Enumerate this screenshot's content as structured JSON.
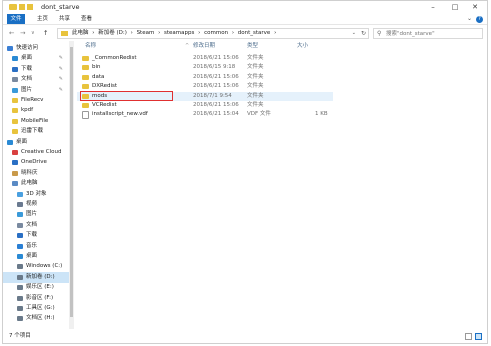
{
  "window": {
    "title": "dont_starve"
  },
  "ribbon": {
    "tabs": [
      "文件",
      "主页",
      "共享",
      "查看"
    ],
    "help": "?"
  },
  "nav_buttons": {
    "back": "←",
    "forward": "→",
    "recent": "∨",
    "up": "↑"
  },
  "address": {
    "crumbs": [
      "此电脑",
      "›",
      "新加卷 (D:)",
      "›",
      "Steam",
      "›",
      "steamapps",
      "›",
      "common",
      "›",
      "dont_starve",
      "›"
    ]
  },
  "search": {
    "placeholder": "搜索\"dont_starve\""
  },
  "sidebar": {
    "items": [
      {
        "label": "快速访问",
        "icon": "star-icon",
        "color": "#3b7fd4"
      },
      {
        "label": "桌面",
        "icon": "desktop-icon",
        "color": "#2a8ad4",
        "pinned": true
      },
      {
        "label": "下载",
        "icon": "download-icon",
        "color": "#2a6fc4",
        "pinned": true
      },
      {
        "label": "文档",
        "icon": "document-icon",
        "color": "#7a8aa0",
        "pinned": true
      },
      {
        "label": "图片",
        "icon": "pictures-icon",
        "color": "#3a9ad9",
        "pinned": true
      },
      {
        "label": "FileRecv",
        "icon": "folder-icon",
        "color": "#e8c33d"
      },
      {
        "label": "kpdf",
        "icon": "folder-icon",
        "color": "#e8c33d"
      },
      {
        "label": "MobileFile",
        "icon": "folder-icon",
        "color": "#e8c33d"
      },
      {
        "label": "迅雷下载",
        "icon": "folder-icon",
        "color": "#e8c33d"
      },
      {
        "label": "桌面",
        "icon": "desktop-icon",
        "color": "#2a8ad4"
      },
      {
        "label": "Creative Cloud",
        "icon": "creative-cloud-icon",
        "color": "#d94040"
      },
      {
        "label": "OneDrive",
        "icon": "cloud-icon",
        "color": "#2a6fc4"
      },
      {
        "label": "晓科庆",
        "icon": "user-icon",
        "color": "#c99a4a"
      },
      {
        "label": "此电脑",
        "icon": "computer-icon",
        "color": "#5a8ac4"
      },
      {
        "label": "3D 对象",
        "icon": "3d-objects-icon",
        "color": "#4aa0e0"
      },
      {
        "label": "视频",
        "icon": "video-icon",
        "color": "#6a7a90"
      },
      {
        "label": "图片",
        "icon": "pictures-icon",
        "color": "#3a9ad9"
      },
      {
        "label": "文档",
        "icon": "document-icon",
        "color": "#7a8aa0"
      },
      {
        "label": "下载",
        "icon": "download-icon",
        "color": "#2a6fc4"
      },
      {
        "label": "音乐",
        "icon": "music-icon",
        "color": "#2a7fd4"
      },
      {
        "label": "桌面",
        "icon": "desktop-icon",
        "color": "#2a8ad4"
      },
      {
        "label": "Windows (C:)",
        "icon": "drive-icon",
        "color": "#6a7a8a"
      },
      {
        "label": "新加卷 (D:)",
        "icon": "drive-icon",
        "color": "#6a7a8a",
        "selected": true
      },
      {
        "label": "娱乐区 (E:)",
        "icon": "drive-icon",
        "color": "#6a7a8a"
      },
      {
        "label": "影音区 (F:)",
        "icon": "drive-icon",
        "color": "#6a7a8a"
      },
      {
        "label": "工具区 (G:)",
        "icon": "drive-icon",
        "color": "#6a7a8a"
      },
      {
        "label": "文档区 (H:)",
        "icon": "drive-icon",
        "color": "#6a7a8a"
      }
    ]
  },
  "columns": {
    "name": "名称",
    "date": "修改日期",
    "type": "类型",
    "size": "大小"
  },
  "files": [
    {
      "name": "_CommonRedist",
      "date": "2018/6/21 15:06",
      "type": "文件夹",
      "size": "",
      "kind": "folder"
    },
    {
      "name": "bin",
      "date": "2018/6/15 9:18",
      "type": "文件夹",
      "size": "",
      "kind": "folder"
    },
    {
      "name": "data",
      "date": "2018/6/21 15:06",
      "type": "文件夹",
      "size": "",
      "kind": "folder"
    },
    {
      "name": "DXRedist",
      "date": "2018/6/21 15:06",
      "type": "文件夹",
      "size": "",
      "kind": "folder"
    },
    {
      "name": "mods",
      "date": "2018/7/1 9:54",
      "type": "文件夹",
      "size": "",
      "kind": "folder",
      "selected": true
    },
    {
      "name": "VCRedist",
      "date": "2018/6/21 15:06",
      "type": "文件夹",
      "size": "",
      "kind": "folder"
    },
    {
      "name": "installscript_new.vdf",
      "date": "2018/6/21 15:04",
      "type": "VDF 文件",
      "size": "1 KB",
      "kind": "file"
    }
  ],
  "status": {
    "count": "7 个项目"
  },
  "colors": {
    "accent": "#1a6fc4",
    "highlight": "#e03030",
    "folder": "#e8c33d"
  }
}
